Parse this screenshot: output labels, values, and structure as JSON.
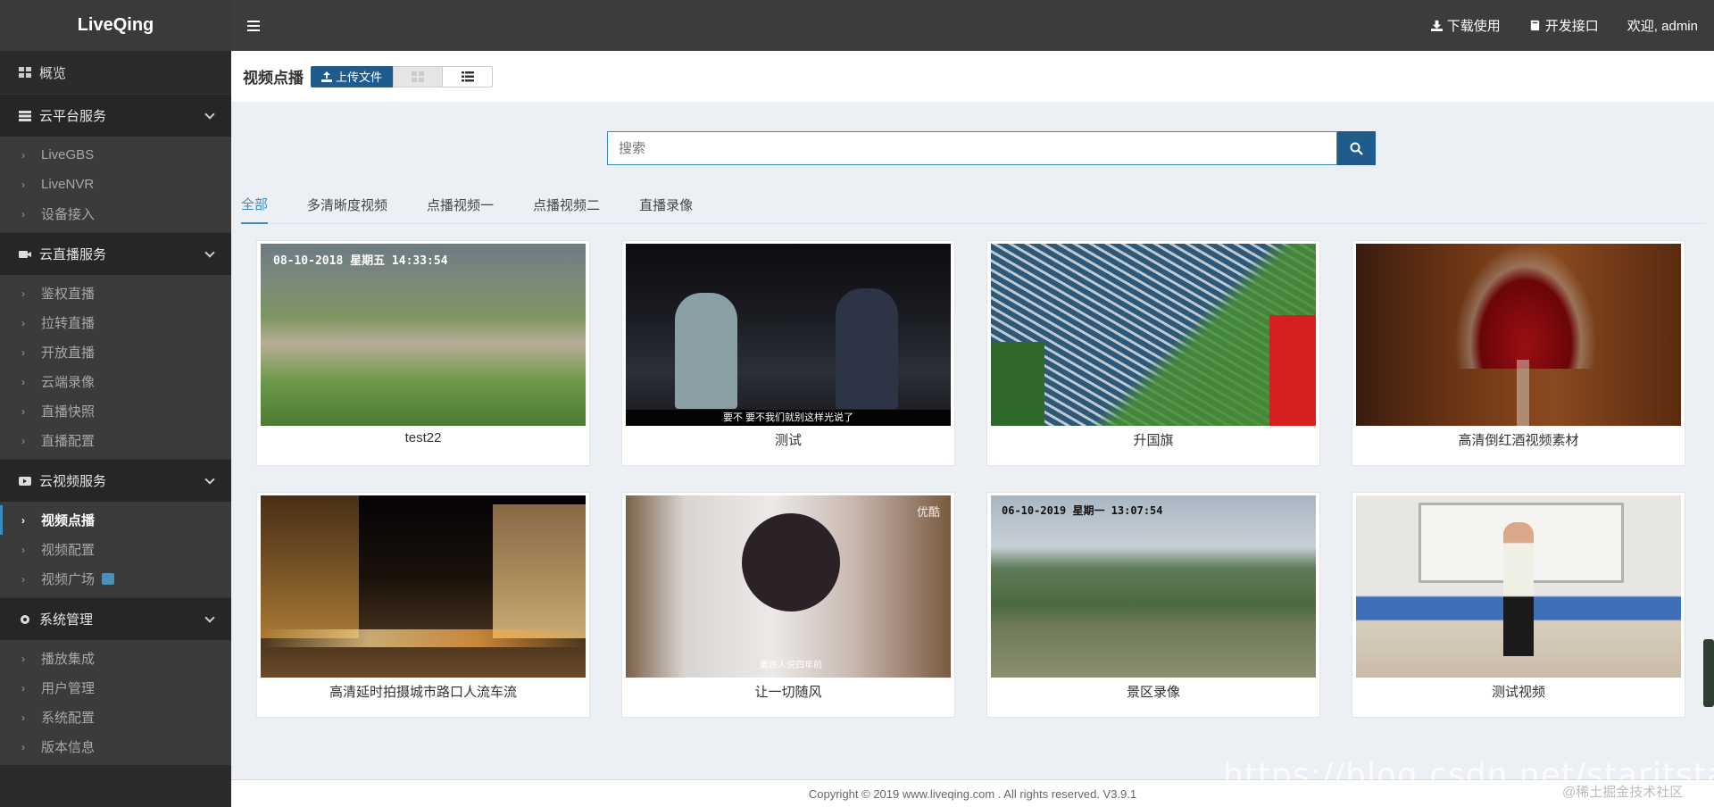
{
  "header": {
    "logo": "LiveQing",
    "download_label": "下载使用",
    "api_label": "开发接口",
    "welcome_label": "欢迎, admin"
  },
  "sidebar": {
    "overview": "概览",
    "groups": [
      {
        "label": "云平台服务",
        "items": [
          "LiveGBS",
          "LiveNVR",
          "设备接入"
        ]
      },
      {
        "label": "云直播服务",
        "items": [
          "鉴权直播",
          "拉转直播",
          "开放直播",
          "云端录像",
          "直播快照",
          "直播配置"
        ]
      },
      {
        "label": "云视频服务",
        "items": [
          "视频点播",
          "视频配置",
          "视频广场"
        ]
      },
      {
        "label": "系统管理",
        "items": [
          "播放集成",
          "用户管理",
          "系统配置",
          "版本信息"
        ]
      }
    ]
  },
  "content": {
    "title": "视频点播",
    "upload_label": "上传文件",
    "search_placeholder": "搜索",
    "tabs": [
      "全部",
      "多清晰度视频",
      "点播视频一",
      "点播视频二",
      "直播录像"
    ],
    "videos": [
      {
        "name": "test22",
        "osd": "08-10-2018 星期五 14:33:54"
      },
      {
        "name": "测试",
        "subtitle": "要不 要不我们就别这样光说了"
      },
      {
        "name": "升国旗"
      },
      {
        "name": "高清倒红酒视频素材"
      },
      {
        "name": "高清延时拍摄城市路口人流车流"
      },
      {
        "name": "让一切随风",
        "brand": "优酷",
        "caption": "姜饼人说四年前"
      },
      {
        "name": "景区录像",
        "osd": "06-10-2019 星期一 13:07:54"
      },
      {
        "name": "测试视频"
      }
    ]
  },
  "footer": {
    "copyright": "Copyright © 2019 www.liveqing.com . All rights reserved. V3.9.1"
  },
  "watermark": {
    "url": "https://blog.csdn.net/staritstarit",
    "site": "@稀土掘金技术社区"
  },
  "colors": {
    "primary": "#1f5c8b",
    "accent": "#3c8dbc",
    "sidebar": "#2b2b2b",
    "header": "#3c3c3c"
  }
}
